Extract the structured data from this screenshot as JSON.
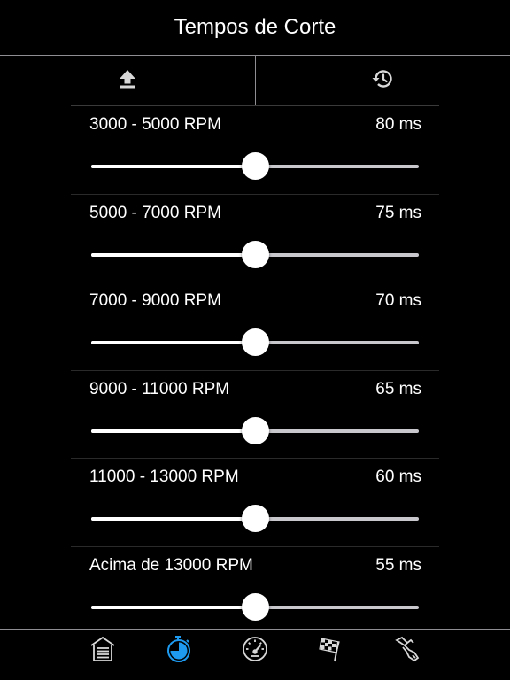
{
  "nav": {
    "title": "Tempos de Corte"
  },
  "actions": [
    {
      "name": "upload",
      "icon": "upload-icon"
    },
    {
      "name": "history",
      "icon": "history-icon"
    }
  ],
  "rows": [
    {
      "label": "3000 - 5000 RPM",
      "value": "80 ms",
      "level": 0.5
    },
    {
      "label": "5000 - 7000 RPM",
      "value": "75 ms",
      "level": 0.5
    },
    {
      "label": "7000 - 9000 RPM",
      "value": "70 ms",
      "level": 0.5
    },
    {
      "label": "9000 - 11000 RPM",
      "value": "65 ms",
      "level": 0.5
    },
    {
      "label": "11000 - 13000 RPM",
      "value": "60 ms",
      "level": 0.5
    },
    {
      "label": "Acima de 13000 RPM",
      "value": "55 ms",
      "level": 0.5
    }
  ],
  "tabs": [
    {
      "icon": "garage-icon",
      "selected": false
    },
    {
      "icon": "stopwatch-icon",
      "selected": true
    },
    {
      "icon": "speedometer-icon",
      "selected": false
    },
    {
      "icon": "checkered-flag-icon",
      "selected": false
    },
    {
      "icon": "fuel-nozzle-icon",
      "selected": false
    }
  ],
  "colors": {
    "background": "#000000",
    "text": "#ffffff",
    "tab_active": "#1e9bf0",
    "tab_inactive": "#d8d8d8",
    "separator": "#8e8e93",
    "slider_track": "#c7c7cc"
  }
}
